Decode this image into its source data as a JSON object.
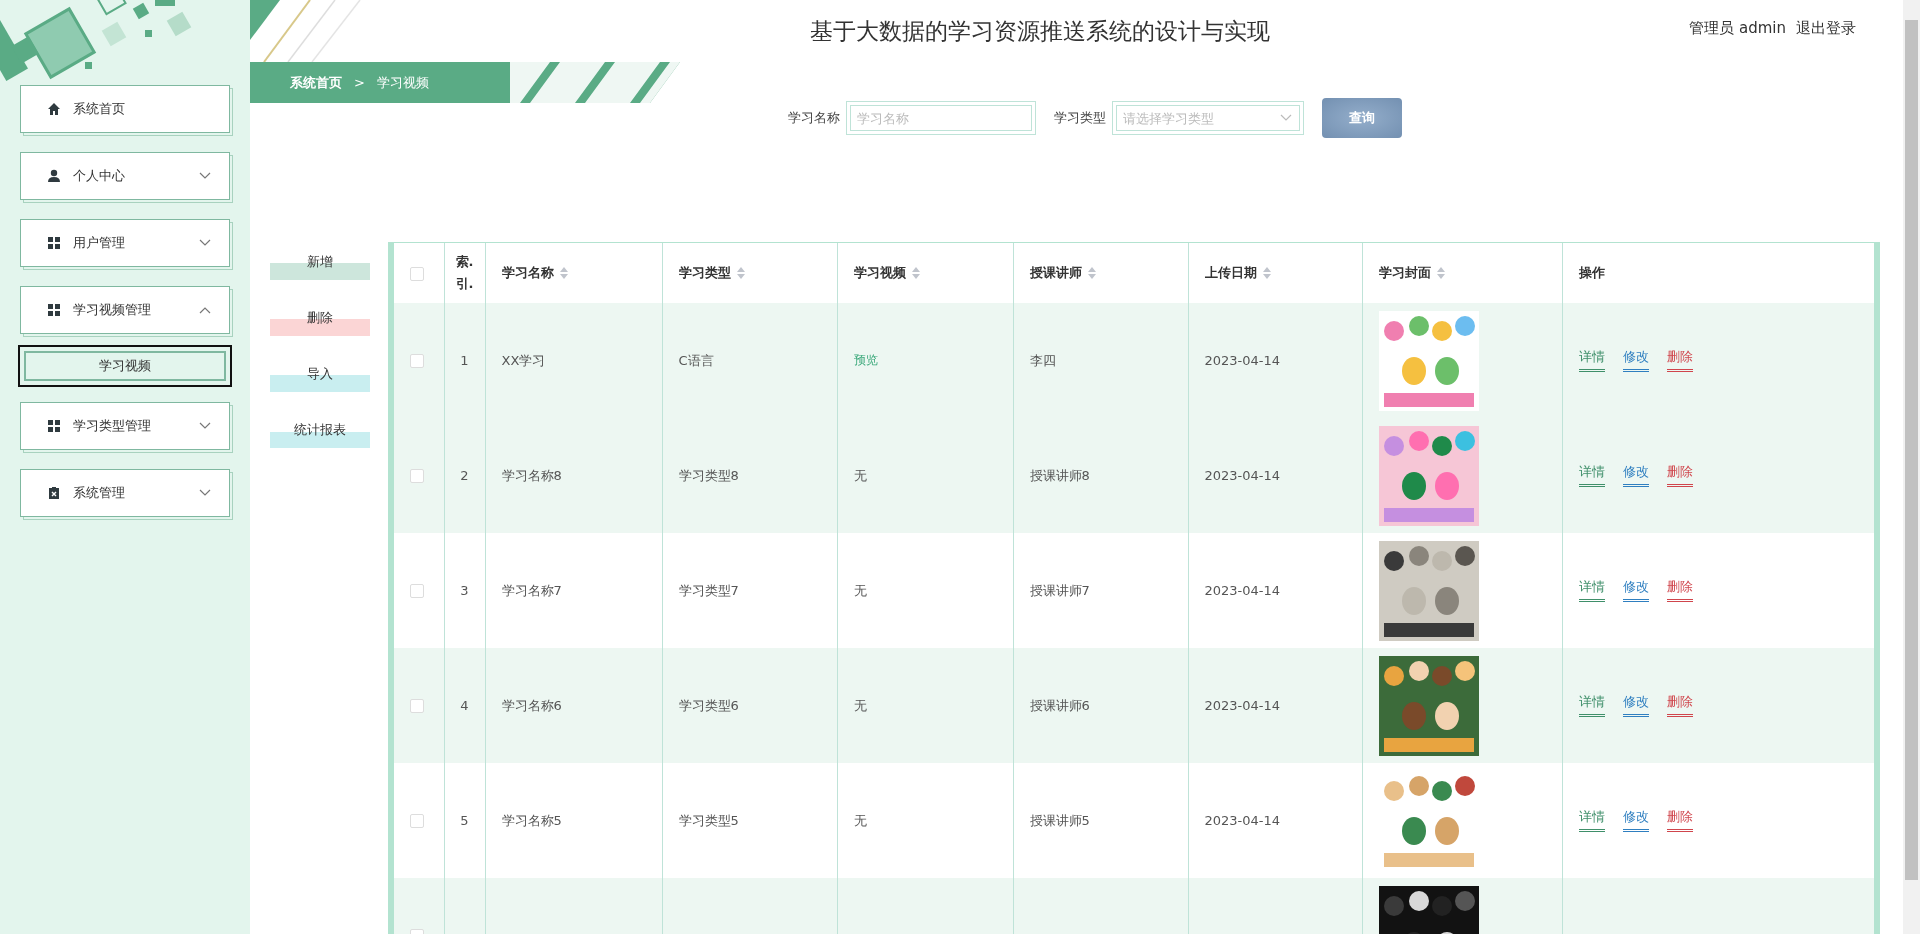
{
  "header": {
    "title": "基于大数据的学习资源推送系统的设计与实现",
    "user": "管理员 admin",
    "logout": "退出登录"
  },
  "sidebar": {
    "items": [
      {
        "label": "系统首页",
        "kind": "home",
        "has_children": false
      },
      {
        "label": "个人中心",
        "kind": "person",
        "has_children": true,
        "expanded": false
      },
      {
        "label": "用户管理",
        "kind": "grid",
        "has_children": true,
        "expanded": false
      },
      {
        "label": "学习视频管理",
        "kind": "grid",
        "has_children": true,
        "expanded": true,
        "children": [
          {
            "label": "学习视频",
            "selected": true
          }
        ]
      },
      {
        "label": "学习类型管理",
        "kind": "grid",
        "has_children": true,
        "expanded": false
      },
      {
        "label": "系统管理",
        "kind": "clipboard",
        "has_children": true,
        "expanded": false
      }
    ]
  },
  "breadcrumb": {
    "home": "系统首页",
    "separator": ">",
    "current": "学习视频"
  },
  "search": {
    "fields": [
      {
        "label": "学习名称",
        "placeholder": "学习名称",
        "kind": "input"
      },
      {
        "label": "学习类型",
        "placeholder": "请选择学习类型",
        "kind": "select"
      }
    ],
    "button": "查询"
  },
  "actions": [
    {
      "label": "新增",
      "color": "#cde6dc"
    },
    {
      "label": "删除",
      "color": "#fbd5d5"
    },
    {
      "label": "导入",
      "color": "#c9eef0"
    },
    {
      "label": "统计报表",
      "color": "#c9eef0"
    }
  ],
  "table": {
    "select_all_checked": false,
    "columns": [
      {
        "label": "索.引."
      },
      {
        "label": "学习名称",
        "sortable": true
      },
      {
        "label": "学习类型",
        "sortable": true
      },
      {
        "label": "学习视频",
        "sortable": true
      },
      {
        "label": "授课讲师",
        "sortable": true
      },
      {
        "label": "上传日期",
        "sortable": true
      },
      {
        "label": "学习封面",
        "sortable": true
      },
      {
        "label": "操作"
      }
    ],
    "rows": [
      {
        "checked": false,
        "highlighted": true,
        "index": "1",
        "name": "XX学习",
        "type": "C语言",
        "video": {
          "text": "预览",
          "kind": "link"
        },
        "teacher": "李四",
        "date": "2023-04-14",
        "cover": {
          "kind": "picture"
        },
        "actions": [
          {
            "label": "详情",
            "kind": "detail"
          },
          {
            "label": "修改",
            "kind": "edit"
          },
          {
            "label": "删除",
            "kind": "delete"
          }
        ]
      },
      {
        "checked": false,
        "highlighted": true,
        "index": "2",
        "name": "学习名称8",
        "type": "学习类型8",
        "video": {
          "text": "无",
          "kind": "text"
        },
        "teacher": "授课讲师8",
        "date": "2023-04-14",
        "cover": {
          "kind": "picture"
        },
        "actions": [
          {
            "label": "详情",
            "kind": "detail"
          },
          {
            "label": "修改",
            "kind": "edit"
          },
          {
            "label": "删除",
            "kind": "delete"
          }
        ]
      },
      {
        "checked": false,
        "highlighted": false,
        "index": "3",
        "name": "学习名称7",
        "type": "学习类型7",
        "video": {
          "text": "无",
          "kind": "text"
        },
        "teacher": "授课讲师7",
        "date": "2023-04-14",
        "cover": {
          "kind": "picture"
        },
        "actions": [
          {
            "label": "详情",
            "kind": "detail"
          },
          {
            "label": "修改",
            "kind": "edit"
          },
          {
            "label": "删除",
            "kind": "delete"
          }
        ]
      },
      {
        "checked": false,
        "highlighted": true,
        "index": "4",
        "name": "学习名称6",
        "type": "学习类型6",
        "video": {
          "text": "无",
          "kind": "text"
        },
        "teacher": "授课讲师6",
        "date": "2023-04-14",
        "cover": {
          "kind": "picture"
        },
        "actions": [
          {
            "label": "详情",
            "kind": "detail"
          },
          {
            "label": "修改",
            "kind": "edit"
          },
          {
            "label": "删除",
            "kind": "delete"
          }
        ]
      },
      {
        "checked": false,
        "highlighted": false,
        "index": "5",
        "name": "学习名称5",
        "type": "学习类型5",
        "video": {
          "text": "无",
          "kind": "text"
        },
        "teacher": "授课讲师5",
        "date": "2023-04-14",
        "cover": {
          "kind": "picture"
        },
        "actions": [
          {
            "label": "详情",
            "kind": "detail"
          },
          {
            "label": "修改",
            "kind": "edit"
          },
          {
            "label": "删除",
            "kind": "delete"
          }
        ]
      },
      {
        "checked": false,
        "highlighted": true,
        "cover": {
          "kind": "picture"
        }
      }
    ]
  }
}
